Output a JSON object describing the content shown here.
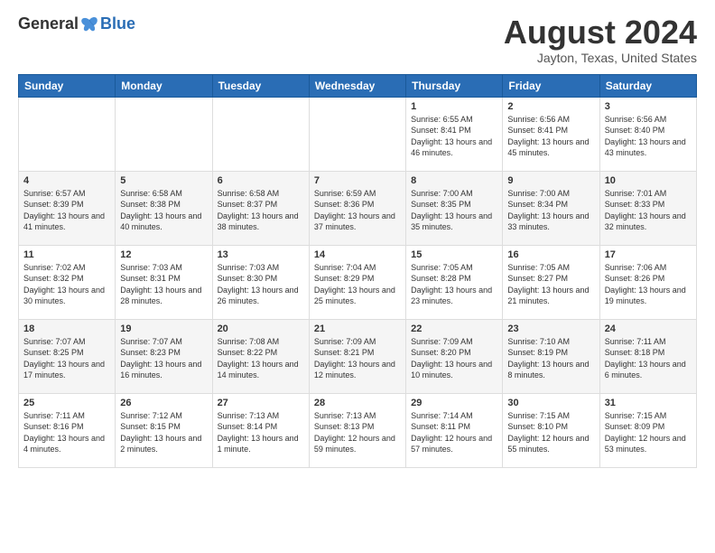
{
  "header": {
    "logo": {
      "general": "General",
      "blue": "Blue"
    },
    "title": "August 2024",
    "location": "Jayton, Texas, United States"
  },
  "days_of_week": [
    "Sunday",
    "Monday",
    "Tuesday",
    "Wednesday",
    "Thursday",
    "Friday",
    "Saturday"
  ],
  "weeks": [
    [
      {
        "day": "",
        "sunrise": "",
        "sunset": "",
        "daylight": ""
      },
      {
        "day": "",
        "sunrise": "",
        "sunset": "",
        "daylight": ""
      },
      {
        "day": "",
        "sunrise": "",
        "sunset": "",
        "daylight": ""
      },
      {
        "day": "",
        "sunrise": "",
        "sunset": "",
        "daylight": ""
      },
      {
        "day": "1",
        "sunrise": "Sunrise: 6:55 AM",
        "sunset": "Sunset: 8:41 PM",
        "daylight": "Daylight: 13 hours and 46 minutes."
      },
      {
        "day": "2",
        "sunrise": "Sunrise: 6:56 AM",
        "sunset": "Sunset: 8:41 PM",
        "daylight": "Daylight: 13 hours and 45 minutes."
      },
      {
        "day": "3",
        "sunrise": "Sunrise: 6:56 AM",
        "sunset": "Sunset: 8:40 PM",
        "daylight": "Daylight: 13 hours and 43 minutes."
      }
    ],
    [
      {
        "day": "4",
        "sunrise": "Sunrise: 6:57 AM",
        "sunset": "Sunset: 8:39 PM",
        "daylight": "Daylight: 13 hours and 41 minutes."
      },
      {
        "day": "5",
        "sunrise": "Sunrise: 6:58 AM",
        "sunset": "Sunset: 8:38 PM",
        "daylight": "Daylight: 13 hours and 40 minutes."
      },
      {
        "day": "6",
        "sunrise": "Sunrise: 6:58 AM",
        "sunset": "Sunset: 8:37 PM",
        "daylight": "Daylight: 13 hours and 38 minutes."
      },
      {
        "day": "7",
        "sunrise": "Sunrise: 6:59 AM",
        "sunset": "Sunset: 8:36 PM",
        "daylight": "Daylight: 13 hours and 37 minutes."
      },
      {
        "day": "8",
        "sunrise": "Sunrise: 7:00 AM",
        "sunset": "Sunset: 8:35 PM",
        "daylight": "Daylight: 13 hours and 35 minutes."
      },
      {
        "day": "9",
        "sunrise": "Sunrise: 7:00 AM",
        "sunset": "Sunset: 8:34 PM",
        "daylight": "Daylight: 13 hours and 33 minutes."
      },
      {
        "day": "10",
        "sunrise": "Sunrise: 7:01 AM",
        "sunset": "Sunset: 8:33 PM",
        "daylight": "Daylight: 13 hours and 32 minutes."
      }
    ],
    [
      {
        "day": "11",
        "sunrise": "Sunrise: 7:02 AM",
        "sunset": "Sunset: 8:32 PM",
        "daylight": "Daylight: 13 hours and 30 minutes."
      },
      {
        "day": "12",
        "sunrise": "Sunrise: 7:03 AM",
        "sunset": "Sunset: 8:31 PM",
        "daylight": "Daylight: 13 hours and 28 minutes."
      },
      {
        "day": "13",
        "sunrise": "Sunrise: 7:03 AM",
        "sunset": "Sunset: 8:30 PM",
        "daylight": "Daylight: 13 hours and 26 minutes."
      },
      {
        "day": "14",
        "sunrise": "Sunrise: 7:04 AM",
        "sunset": "Sunset: 8:29 PM",
        "daylight": "Daylight: 13 hours and 25 minutes."
      },
      {
        "day": "15",
        "sunrise": "Sunrise: 7:05 AM",
        "sunset": "Sunset: 8:28 PM",
        "daylight": "Daylight: 13 hours and 23 minutes."
      },
      {
        "day": "16",
        "sunrise": "Sunrise: 7:05 AM",
        "sunset": "Sunset: 8:27 PM",
        "daylight": "Daylight: 13 hours and 21 minutes."
      },
      {
        "day": "17",
        "sunrise": "Sunrise: 7:06 AM",
        "sunset": "Sunset: 8:26 PM",
        "daylight": "Daylight: 13 hours and 19 minutes."
      }
    ],
    [
      {
        "day": "18",
        "sunrise": "Sunrise: 7:07 AM",
        "sunset": "Sunset: 8:25 PM",
        "daylight": "Daylight: 13 hours and 17 minutes."
      },
      {
        "day": "19",
        "sunrise": "Sunrise: 7:07 AM",
        "sunset": "Sunset: 8:23 PM",
        "daylight": "Daylight: 13 hours and 16 minutes."
      },
      {
        "day": "20",
        "sunrise": "Sunrise: 7:08 AM",
        "sunset": "Sunset: 8:22 PM",
        "daylight": "Daylight: 13 hours and 14 minutes."
      },
      {
        "day": "21",
        "sunrise": "Sunrise: 7:09 AM",
        "sunset": "Sunset: 8:21 PM",
        "daylight": "Daylight: 13 hours and 12 minutes."
      },
      {
        "day": "22",
        "sunrise": "Sunrise: 7:09 AM",
        "sunset": "Sunset: 8:20 PM",
        "daylight": "Daylight: 13 hours and 10 minutes."
      },
      {
        "day": "23",
        "sunrise": "Sunrise: 7:10 AM",
        "sunset": "Sunset: 8:19 PM",
        "daylight": "Daylight: 13 hours and 8 minutes."
      },
      {
        "day": "24",
        "sunrise": "Sunrise: 7:11 AM",
        "sunset": "Sunset: 8:18 PM",
        "daylight": "Daylight: 13 hours and 6 minutes."
      }
    ],
    [
      {
        "day": "25",
        "sunrise": "Sunrise: 7:11 AM",
        "sunset": "Sunset: 8:16 PM",
        "daylight": "Daylight: 13 hours and 4 minutes."
      },
      {
        "day": "26",
        "sunrise": "Sunrise: 7:12 AM",
        "sunset": "Sunset: 8:15 PM",
        "daylight": "Daylight: 13 hours and 2 minutes."
      },
      {
        "day": "27",
        "sunrise": "Sunrise: 7:13 AM",
        "sunset": "Sunset: 8:14 PM",
        "daylight": "Daylight: 13 hours and 1 minute."
      },
      {
        "day": "28",
        "sunrise": "Sunrise: 7:13 AM",
        "sunset": "Sunset: 8:13 PM",
        "daylight": "Daylight: 12 hours and 59 minutes."
      },
      {
        "day": "29",
        "sunrise": "Sunrise: 7:14 AM",
        "sunset": "Sunset: 8:11 PM",
        "daylight": "Daylight: 12 hours and 57 minutes."
      },
      {
        "day": "30",
        "sunrise": "Sunrise: 7:15 AM",
        "sunset": "Sunset: 8:10 PM",
        "daylight": "Daylight: 12 hours and 55 minutes."
      },
      {
        "day": "31",
        "sunrise": "Sunrise: 7:15 AM",
        "sunset": "Sunset: 8:09 PM",
        "daylight": "Daylight: 12 hours and 53 minutes."
      }
    ]
  ]
}
